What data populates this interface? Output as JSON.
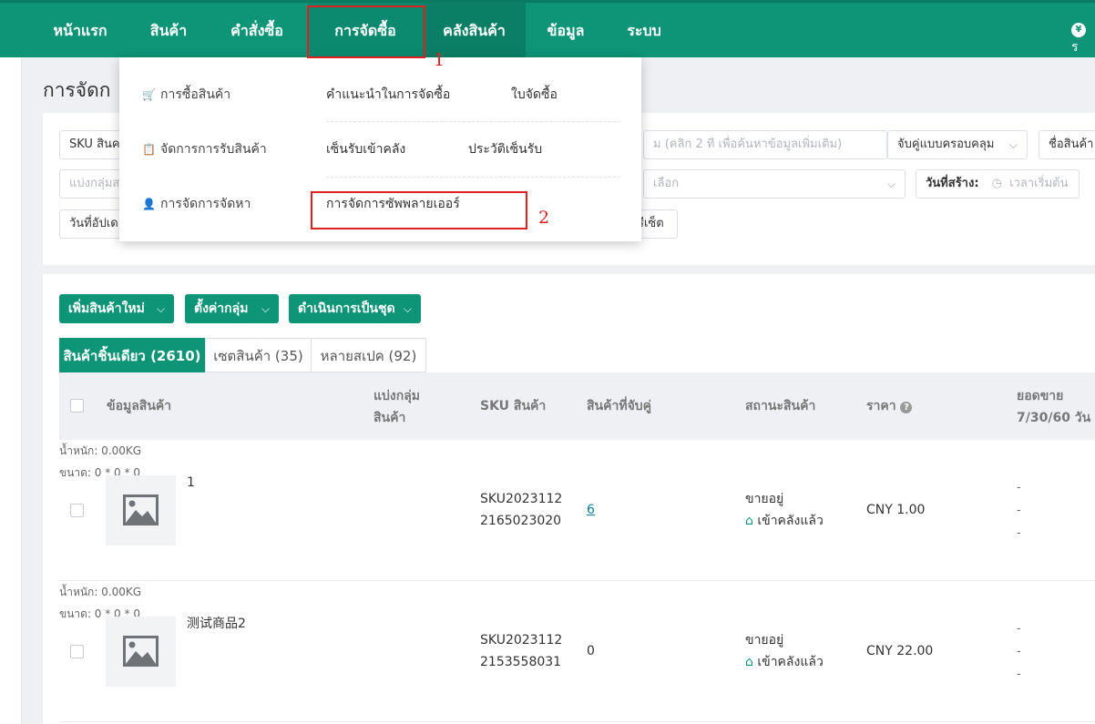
{
  "nav": {
    "items": [
      "หน้าแรก",
      "สินค้า",
      "คำสั่งซื้อ",
      "การจัดซื้อ",
      "คลังสินค้า",
      "ข้อมูล",
      "ระบบ"
    ],
    "right_glyph": "¥",
    "right_text": "ร"
  },
  "annotations": {
    "one": "1",
    "two": "2"
  },
  "page_title": "การจัดก",
  "filters": {
    "sku_prefix": "SKU สินค",
    "search_hint": "ม  (คลิก 2 ที เพื่อค้นหาข้อมูลเพิ่มเติม)",
    "match_mode": "จับคู่แบบครอบคลุม",
    "product_name": "ชื่อสินค้า",
    "group_placeholder": "แบ่งกลุ่มส",
    "select_placeholder": "เลือก",
    "created_label": "วันที่สร้าง:",
    "start_time": "เวลาเริ่มต้น",
    "updated_label": "วันที่อัปเด",
    "reset": "รีเซ็ต"
  },
  "dropdown": {
    "purchase": "การซื้อสินค้า",
    "receive": "จัดการการรับสินค้า",
    "sourcing": "การจัดการจัดหา",
    "purchase_advice": "คำแนะนำในการจัดซื้อ",
    "purchase_order": "ใบจัดซื้อ",
    "receive_sign": "เซ็นรับเข้าคลัง",
    "receive_history": "ประวัติเซ็นรับ",
    "supplier_mgmt": "การจัดการซัพพลายเออร์"
  },
  "actions": {
    "add_product": "เพิ่มสินค้าใหม่",
    "set_group": "ตั้งค่ากลุ่ม",
    "batch": "ดำเนินการเป็นชุด"
  },
  "tabs": [
    "สินค้าชิ้นเดียว (2610)",
    "เซตสินค้า (35)",
    "หลายสเปค (92)"
  ],
  "table": {
    "headers": {
      "product_info": "ข้อมูลสินค้า",
      "group_1": "แบ่งกลุ่ม",
      "group_2": "สินค้า",
      "sku": "SKU สินค้า",
      "paired": "สินค้าที่จับคู่",
      "status": "สถานะสินค้า",
      "price": "ราคา",
      "sales_1": "ยอดขาย",
      "sales_2": "7/30/60 วัน"
    },
    "rows": [
      {
        "name": "1",
        "weight": "น้ำหนัก:  0.00KG",
        "size": "ขนาด:  0 * 0 * 0",
        "sku_1": "SKU2023112",
        "sku_2": "2165023020",
        "paired": "6",
        "status": "ขายอยู่",
        "stock": "เข้าคลังแล้ว",
        "price": "CNY 1.00",
        "sales": [
          "-",
          "-",
          "-"
        ]
      },
      {
        "name": "测试商品2",
        "weight": "น้ำหนัก:  0.00KG",
        "size": "ขนาด:  0 * 0 * 0",
        "sku_1": "SKU2023112",
        "sku_2": "2153558031",
        "paired": "0",
        "status": "ขายอยู่",
        "stock": "เข้าคลังแล้ว",
        "price": "CNY 22.00",
        "sales": [
          "-",
          "-",
          "-"
        ]
      }
    ]
  },
  "colors": {
    "brand": "#0e9477",
    "annotation": "#e02020"
  }
}
